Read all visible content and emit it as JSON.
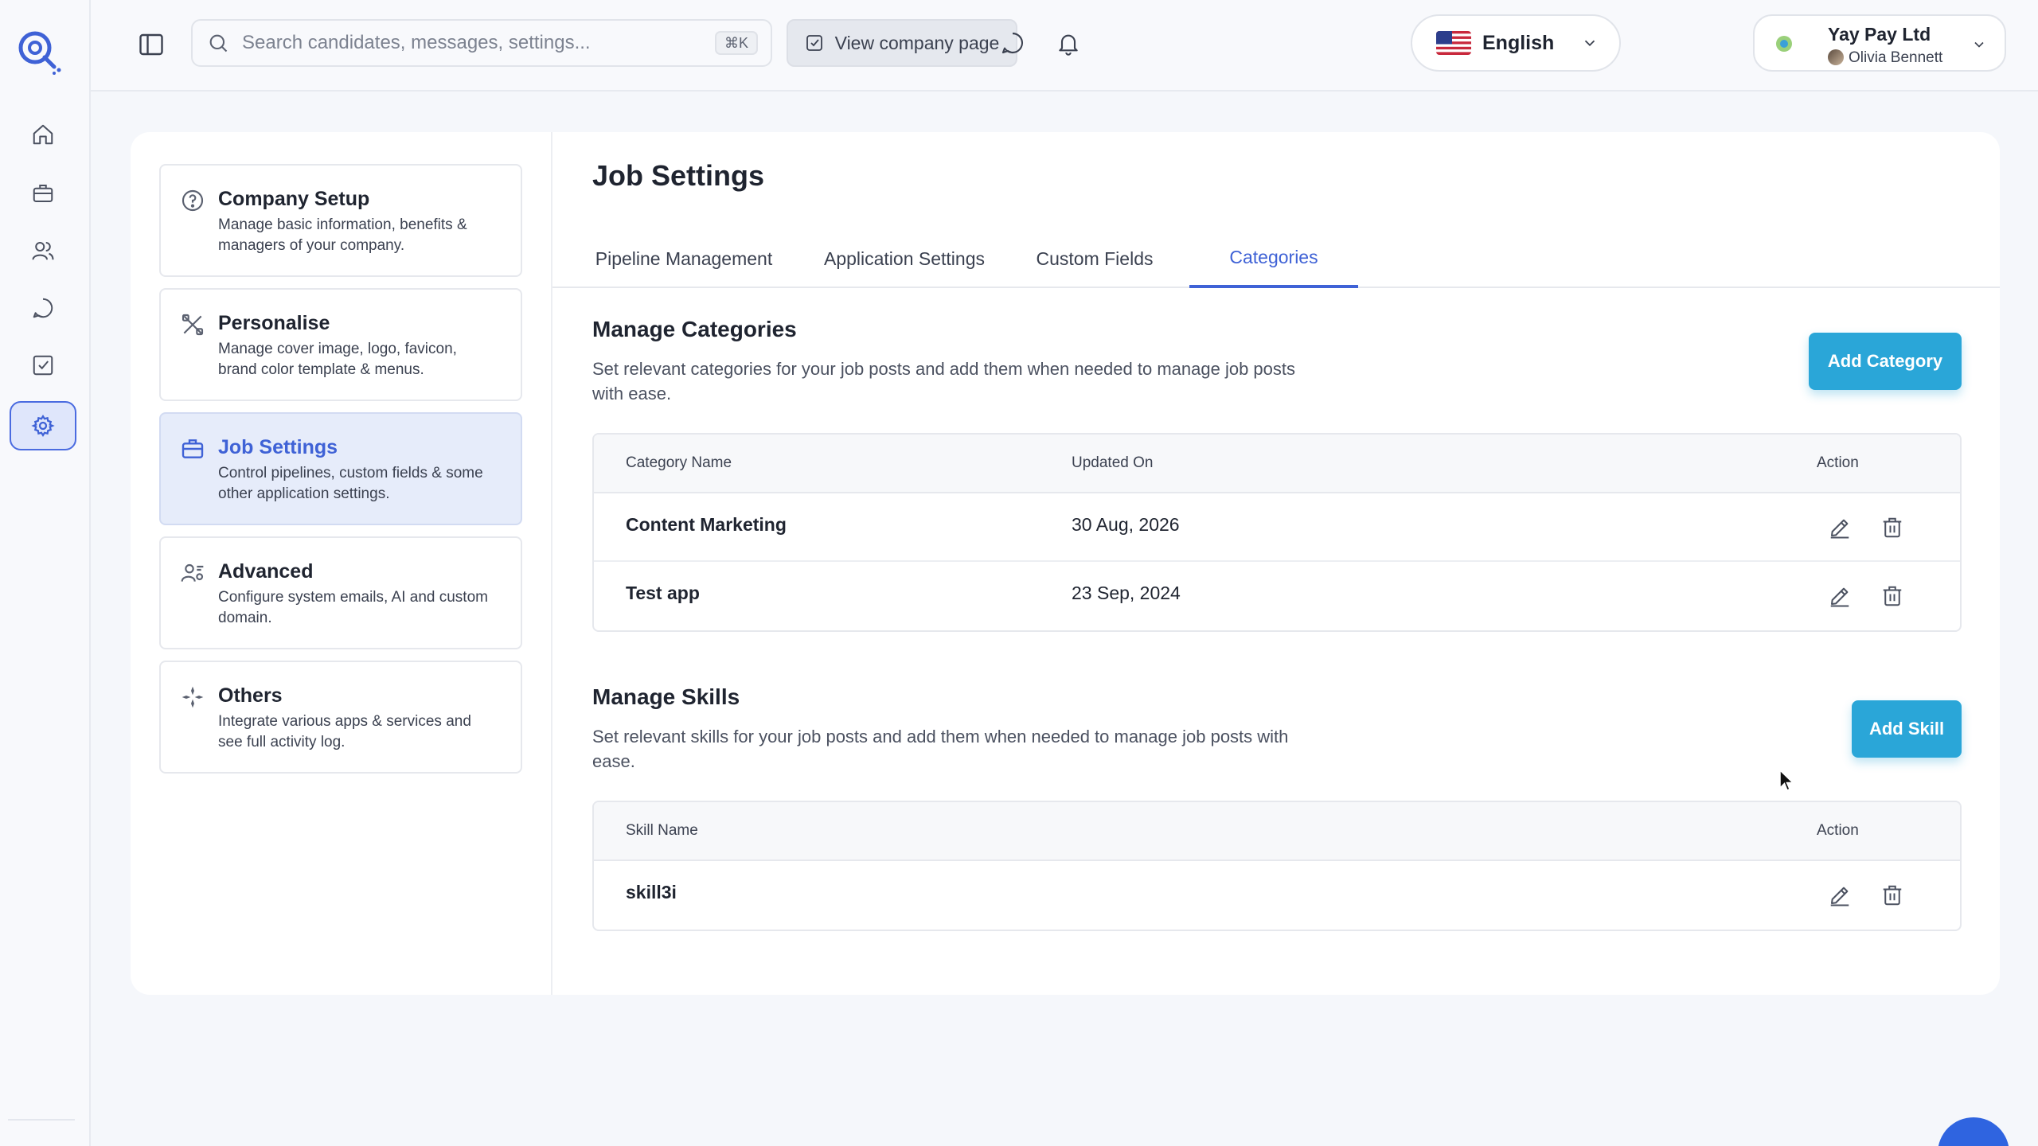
{
  "topbar": {
    "search_placeholder": "Search candidates, messages, settings...",
    "search_shortcut": "⌘K",
    "view_company_label": "View company page",
    "language": "English",
    "account": {
      "company": "Yay Pay Ltd",
      "user": "Olivia Bennett"
    }
  },
  "rail": {
    "items": [
      "home-icon",
      "briefcase-icon",
      "users-icon",
      "chat-icon",
      "checklist-icon",
      "gear-icon"
    ],
    "active": "gear-icon"
  },
  "settings_nav": {
    "items": [
      {
        "title": "Company Setup",
        "desc": "Manage basic information, benefits & managers of your company."
      },
      {
        "title": "Personalise",
        "desc": "Manage cover image, logo, favicon, brand color template & menus."
      },
      {
        "title": "Job Settings",
        "desc": "Control pipelines, custom fields & some other application settings."
      },
      {
        "title": "Advanced",
        "desc": "Configure system emails, AI and custom domain."
      },
      {
        "title": "Others",
        "desc": "Integrate various apps & services and see full activity log."
      }
    ],
    "active": "Job Settings"
  },
  "page": {
    "title": "Job Settings",
    "tabs": [
      "Pipeline Management",
      "Application Settings",
      "Custom Fields",
      "Categories"
    ],
    "active_tab": "Categories"
  },
  "categories": {
    "title": "Manage Categories",
    "desc": "Set relevant categories for your job posts and add them when needed to manage job posts with ease.",
    "add_label": "Add Category",
    "columns": [
      "Category Name",
      "Updated On",
      "Action"
    ],
    "rows": [
      {
        "name": "Content Marketing",
        "updated": "30 Aug, 2026"
      },
      {
        "name": "Test app",
        "updated": "23 Sep, 2024"
      }
    ]
  },
  "skills": {
    "title": "Manage Skills",
    "desc": "Set relevant skills for your job posts and add them when needed to manage job posts with ease.",
    "add_label": "Add Skill",
    "columns": [
      "Skill Name",
      "Action"
    ],
    "rows": [
      {
        "name": "skill3i"
      }
    ]
  },
  "colors": {
    "accent": "#3f62d6",
    "button": "#2aa6d8",
    "background": "#f5f7fb"
  }
}
